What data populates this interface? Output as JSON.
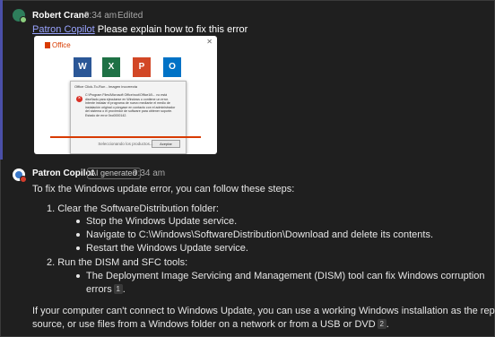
{
  "message1": {
    "author": "Robert Crane",
    "time": "9:34 am",
    "status": "Edited",
    "mention": "Patron Copilot",
    "text": "Please explain how to fix this error",
    "attachment": {
      "logo": "Office",
      "close": "✕",
      "tiles": [
        {
          "letter": "W",
          "color": "#2b5797"
        },
        {
          "letter": "X",
          "color": "#1e7145"
        },
        {
          "letter": "P",
          "color": "#d24726"
        },
        {
          "letter": "O",
          "color": "#0072c6"
        }
      ],
      "dialog_title": "Office Click-To-Run - Imagen incorrecta",
      "dialog_text": "C:\\Program Files\\Microsoft Office\\root\\Office16\\... no está diseñado para ejecutarse en Windows o contiene un error. Intente instalar el programa de nuevo mediante el medio de instalación original o póngase en contacto con el administrador del sistema o el proveedor de software para obtener soporte. Estado de error 0xc0000142.",
      "dialog_ok": "Aceptar",
      "footer": "Seleccionando los productos..."
    }
  },
  "message2": {
    "author": "Patron Copilot",
    "badge": "AI generated",
    "time": "9:34 am",
    "intro": "To fix the Windows update error, you can follow these steps:",
    "step1": "1. Clear the SoftwareDistribution folder:",
    "step1_bullets": [
      "Stop the Windows Update service.",
      "Navigate to C:\\Windows\\SoftwareDistribution\\Download and delete its contents.",
      "Restart the Windows Update service."
    ],
    "step2": "2. Run the DISM and SFC tools:",
    "step2_bullet_line1": "The Deployment Image Servicing and Management (DISM) tool can fix Windows corruption",
    "step2_bullet_line2": "errors",
    "ref1": "1",
    "closing_line1": "If your computer can't connect to Windows Update, you can use a working Windows installation as the repair",
    "closing_line2": "source, or use files from a Windows folder on a network or from a USB or DVD",
    "ref2": "2"
  }
}
